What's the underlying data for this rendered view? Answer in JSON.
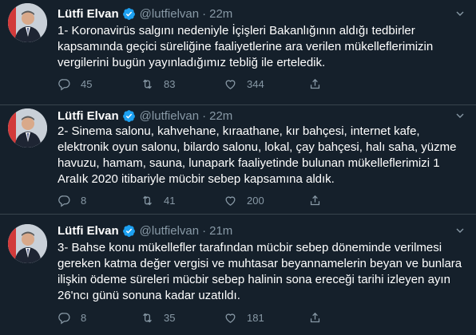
{
  "tweets": [
    {
      "name": "Lütfi Elvan",
      "handle": "@lutfielvan",
      "separator": "·",
      "time": "22m",
      "text": "1- Koronavirüs salgını nedeniyle İçişleri Bakanlığının aldığı tedbirler\nkapsamında geçici süreliğine faaliyetlerine ara verilen mükelleflerimizin\nvergilerini bugün yayınladığımız tebliğ ile erteledik.",
      "replies": "45",
      "retweets": "83",
      "likes": "344"
    },
    {
      "name": "Lütfi Elvan",
      "handle": "@lutfielvan",
      "separator": "·",
      "time": "22m",
      "text": "2- Sinema salonu, kahvehane, kıraathane, kır bahçesi, internet kafe,\nelektronik oyun salonu, bilardo salonu, lokal, çay bahçesi, halı saha, yüzme\nhavuzu, hamam, sauna, lunapark faaliyetinde bulunan mükelleflerimizi 1\nAralık 2020 itibariyle mücbir sebep kapsamına aldık.",
      "replies": "8",
      "retweets": "41",
      "likes": "200"
    },
    {
      "name": "Lütfi Elvan",
      "handle": "@lutfielvan",
      "separator": "·",
      "time": "21m",
      "text": "3- Bahse konu mükellefler tarafından mücbir sebep döneminde verilmesi\ngereken katma değer vergisi ve muhtasar beyannamelerin beyan ve bunlara\nilişkin ödeme süreleri mücbir sebep halinin sona ereceği tarihi izleyen ayın\n26'ncı günü sonuna kadar uzatıldı.",
      "replies": "8",
      "retweets": "35",
      "likes": "181"
    }
  ],
  "icons": {
    "verified": "verified-badge-icon",
    "more": "chevron-down-icon",
    "reply": "reply-icon",
    "retweet": "retweet-icon",
    "like": "heart-icon",
    "share": "share-icon"
  },
  "colors": {
    "background": "#15202b",
    "text": "#ffffff",
    "secondary": "#8899a6",
    "verified": "#1da1f2",
    "divider": "#38444d"
  }
}
